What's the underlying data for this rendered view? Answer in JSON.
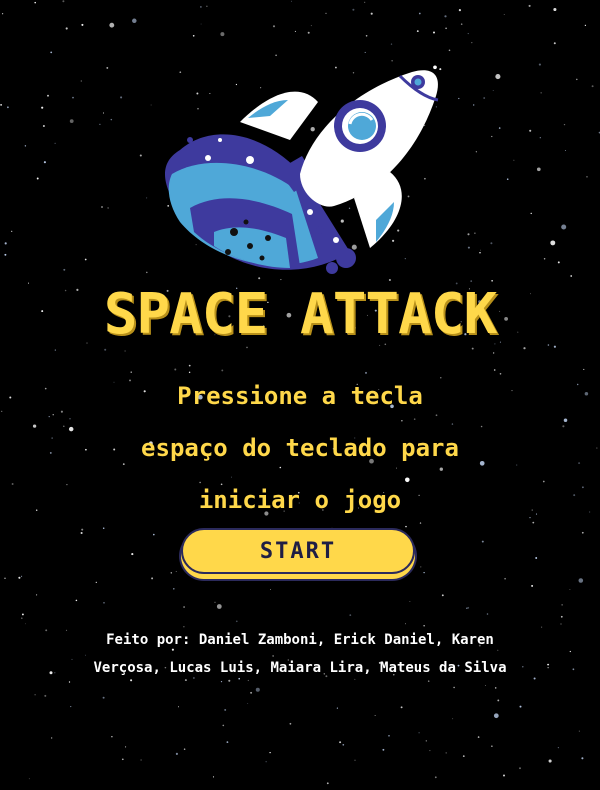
{
  "game": {
    "title": "SPACE ATTACK",
    "instructions": [
      "Pressione a tecla",
      "espaço do teclado para",
      "iniciar o jogo"
    ],
    "start_label": "START",
    "credits": [
      "Feito por: Daniel Zamboni, Erick Daniel, Karen",
      "Verçosa, Lucas Luis, Maiara Lira, Mateus da Silva"
    ]
  },
  "colors": {
    "background": "#000000",
    "accent": "#FFD84A",
    "button_border": "#2B2A5C",
    "trail_dark": "#3E3A9E",
    "trail_light": "#4FA8D8",
    "rocket_body": "#FFFFFF"
  },
  "icons": {
    "logo": "rocket-icon"
  }
}
